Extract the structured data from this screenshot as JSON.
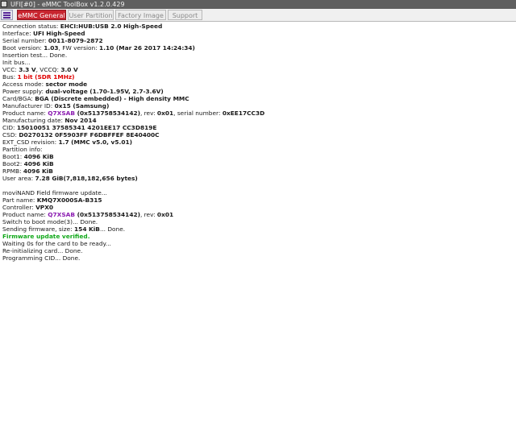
{
  "window": {
    "title": "UFI[#0] - eMMC ToolBox v1.2.0.429"
  },
  "toolbar": {
    "menu_icon": "hamburger-menu-icon",
    "tabs": [
      {
        "label": "eMMC General",
        "active": true
      },
      {
        "label": "User Partition",
        "active": false
      },
      {
        "label": "Factory Image",
        "active": false
      },
      {
        "label": "Support",
        "active": false
      }
    ],
    "accent_color": "#c8252f"
  },
  "log": {
    "connection_label": "Connection status: ",
    "connection_value": "EHCI:HUB:USB 2.0 High-Speed",
    "interface_label": "Interface: ",
    "interface_value": "UFI High-Speed",
    "serial_label": "Serial number: ",
    "serial_value": "0011-8079-2872",
    "boot_label": " Boot version: ",
    "boot_value": "1.03",
    "fw_label": ", FW version: ",
    "fw_value": "1.10 (Mar 26 2017 14:24:34)",
    "insertion": "Insertion test... Done.",
    "init_bus": "Init bus...",
    "vcc_label": "VCC: ",
    "vcc_value": "3.3 V",
    "vccq_label": ", VCCQ: ",
    "vccq_value": "3.0 V",
    "bus_label": "Bus: ",
    "bus_value": "1 bit (SDR 1MHz)",
    "access_label": "Access mode: ",
    "access_value": "sector mode",
    "power_label": "Power supply: ",
    "power_value": "dual-voltage (1.70-1.95V, 2.7-3.6V)",
    "card_label": " Card/BGA: ",
    "card_value": "BGA (Discrete embedded) - High density MMC",
    "manufacturer_label": "Manufacturer ID: ",
    "manufacturer_value": "0x15 (Samsung)",
    "product_label": " Product name: ",
    "product_value": "Q7XSAB",
    "product_hex": " (0x513758534142)",
    "rev_label": ", rev: ",
    "rev_value": "0x01",
    "product_serial_label": ", serial number: ",
    "product_serial_value": "0xEE17CC3D",
    "mfg_date_label": " Manufacturing date: ",
    "mfg_date_value": "Nov 2014",
    "cid_label": "CID: ",
    "cid_value": "15010051 37585341 4201EE17 CC3D819E",
    "csd_label": "CSD: ",
    "csd_value": "D0270132 0F5903FF F6DBFFEF 8E40400C",
    "ext_csd_label": "EXT_CSD revision: ",
    "ext_csd_value": "1.7 (MMC v5.0, v5.01)",
    "partition_info": "Partition info:",
    "boot1_label": " Boot1: ",
    "boot1_value": "4096 KiB",
    "boot2_label": " Boot2: ",
    "boot2_value": "4096 KiB",
    "rpmb_label": " RPMB: ",
    "rpmb_value": "4096 KiB",
    "user_area_label": " User area: ",
    "user_area_value": "7.28 GiB(7,818,182,656 bytes)",
    "fw_update_title": "moviNAND Field firmware update...",
    "part_label": "Part name: ",
    "part_value": "KMQ7X000SA-B315",
    "controller_label": " Controller: ",
    "controller_value": "VPX0",
    "product2_label": " Product name: ",
    "product2_value": "Q7XSAB",
    "product2_hex": " (0x513758534142)",
    "rev2_label": ", rev: ",
    "rev2_value": "0x01",
    "switch_boot": "Switch to boot mode(3)... Done.",
    "sending_label": "Sending firmware, size: ",
    "sending_value": "154 KiB",
    "sending_suffix": "... Done.",
    "verified": "Firmware update verified.",
    "waiting": "Waiting 0s for the card to be ready...",
    "reinit": "Re-initializing card... Done.",
    "programming": "Programming CID... Done."
  }
}
